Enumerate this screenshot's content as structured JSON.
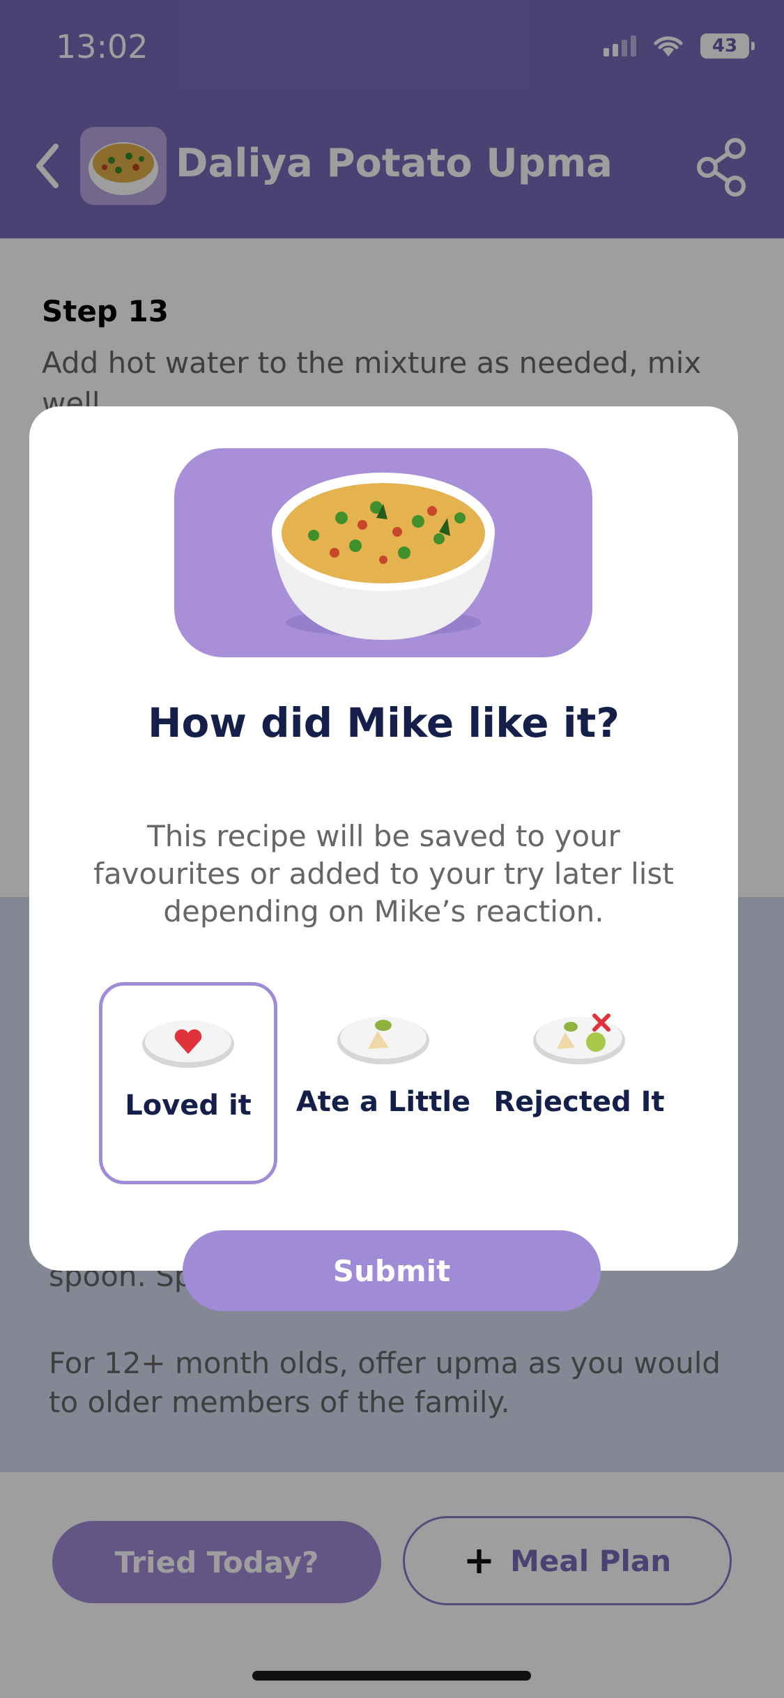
{
  "status_bar": {
    "time": "13:02",
    "battery": "43"
  },
  "header": {
    "title": "Daliya Potato Upma"
  },
  "content": {
    "step_title": "Step 13",
    "step_text": "Add hot water to the mixture as needed, mix well.",
    "lower_text_1": "spoon. Sp",
    "lower_text_2": "For 12+ month olds, offer upma as you would to older members of the family."
  },
  "bottom_bar": {
    "tried_label": "Tried Today?",
    "meal_plan_label": "Meal Plan"
  },
  "modal": {
    "title": "How did Mike like it?",
    "description": "This recipe will be saved to your favourites or added to your try later list depending on Mike’s reaction.",
    "options": [
      {
        "label": "Loved it",
        "icon": "heart-plate-icon",
        "selected": true
      },
      {
        "label": "Ate a Little",
        "icon": "food-plate-icon",
        "selected": false
      },
      {
        "label": "Rejected It",
        "icon": "rejected-plate-icon",
        "selected": false
      }
    ],
    "submit_label": "Submit"
  },
  "colors": {
    "accent": "#a08bd6",
    "header": "#7a6aba",
    "title": "#14204a"
  }
}
